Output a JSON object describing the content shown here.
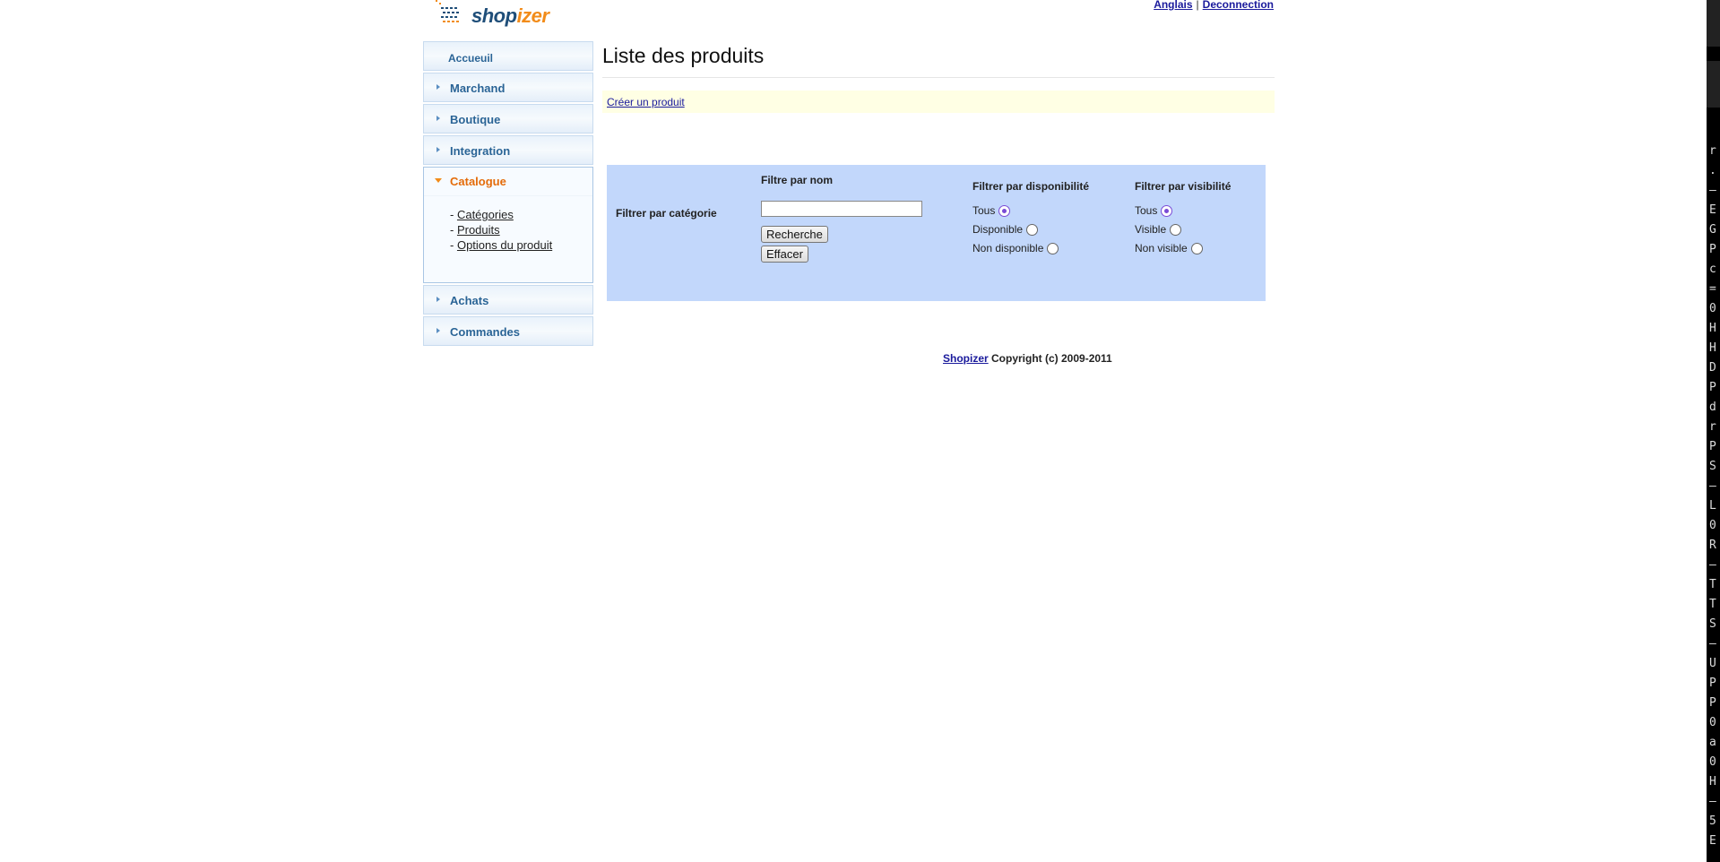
{
  "header": {
    "logo_shop": "shop",
    "logo_izer": "izer",
    "link_language": "Anglais",
    "separator": "|",
    "link_logout": "Deconnection"
  },
  "sidebar": {
    "home": "Accueuil",
    "items": [
      "Marchand",
      "Boutique",
      "Integration"
    ],
    "open_section": {
      "label": "Catalogue",
      "children": [
        {
          "prefix": "- ",
          "label": "Catégories"
        },
        {
          "prefix": "- ",
          "label": "Produits"
        },
        {
          "prefix": "- ",
          "label": "Options du produit"
        }
      ]
    },
    "items_after": [
      "Achats",
      "Commandes"
    ]
  },
  "main": {
    "title": "Liste des produits",
    "create_link": "Créer un produit",
    "filter": {
      "category_label": "Filtrer par catégorie",
      "name_label": "Filtre par nom",
      "name_value": "",
      "search_button": "Recherche",
      "clear_button": "Effacer",
      "availability_label": "Filtrer par disponibilité",
      "availability_options": [
        {
          "label": "Tous",
          "checked": true
        },
        {
          "label": "Disponible",
          "checked": false
        },
        {
          "label": "Non disponible",
          "checked": false
        }
      ],
      "visibility_label": "Filtrer par visibilité",
      "visibility_options": [
        {
          "label": "Tous",
          "checked": true
        },
        {
          "label": "Visible",
          "checked": false
        },
        {
          "label": "Non visible",
          "checked": false
        }
      ]
    }
  },
  "footer": {
    "brand_link": "Shopizer",
    "copyright": " Copyright (c) 2009-2011"
  },
  "terminal": {
    "chars": [
      "r",
      ".",
      "—",
      "E",
      "G",
      "P",
      "c",
      "=",
      "0",
      "H",
      "H",
      "D",
      "P",
      "d",
      "r",
      "P",
      " ",
      "S",
      "—",
      "L",
      "0",
      "R",
      "—",
      "T",
      "T",
      "S",
      "—",
      "U",
      "P",
      "P",
      "0",
      "a",
      "0",
      "H",
      "—",
      "5",
      "E"
    ]
  },
  "colors": {
    "accent_orange": "#e46c0a",
    "nav_blue": "#2a6496",
    "filter_bg": "#c2d7fb",
    "create_bar_bg": "#ffffe4"
  }
}
